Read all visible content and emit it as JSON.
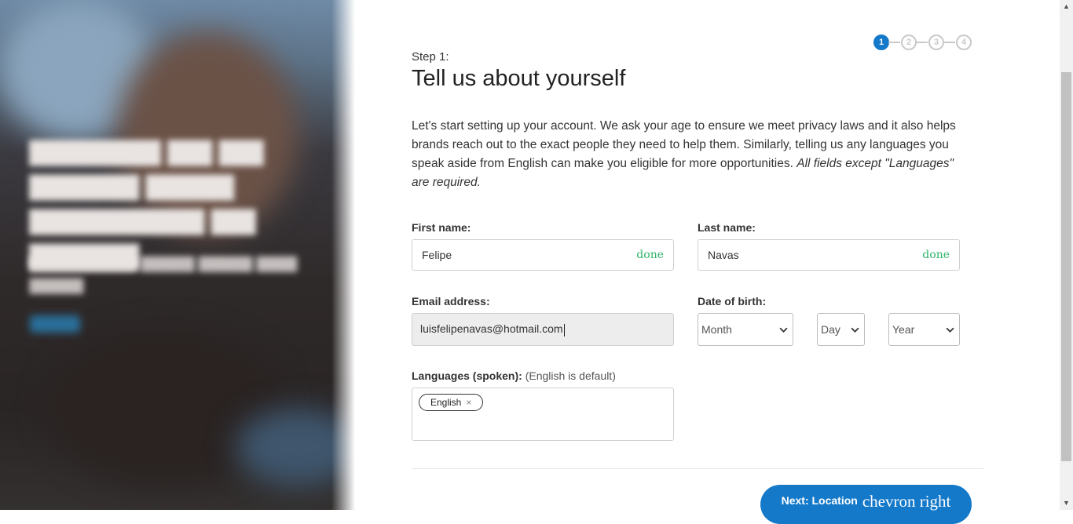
{
  "hero": {
    "note": ""
  },
  "stepper": {
    "steps": [
      "1",
      "2",
      "3",
      "4"
    ],
    "active": 1
  },
  "form": {
    "step_label": "Step 1:",
    "title": "Tell us about yourself",
    "intro_text": "Let's start setting up your account. We ask your age to ensure we meet privacy laws and it also helps brands reach out to the exact people they need to help them. Similarly, telling us any languages you speak aside from English can make you eligible for more opportunities. ",
    "intro_emphasis": "All fields except \"Languages\" are required.",
    "first_name": {
      "label": "First name:",
      "value": "Felipe",
      "status": "done"
    },
    "last_name": {
      "label": "Last name:",
      "value": "Navas",
      "status": "done"
    },
    "email": {
      "label": "Email address:",
      "value": "luisfelipenavas@hotmail.com"
    },
    "dob": {
      "label": "Date of birth:",
      "month": "Month",
      "day": "Day",
      "year": "Year"
    },
    "languages": {
      "label": "Languages (spoken):",
      "hint": "(English is default)",
      "chips": [
        {
          "label": "English",
          "remove": "×"
        }
      ]
    },
    "next_button": {
      "label": "Next: Location",
      "icon_text": "chevron_right"
    }
  },
  "colors": {
    "accent": "#1479c9",
    "done": "#2fb56a"
  }
}
